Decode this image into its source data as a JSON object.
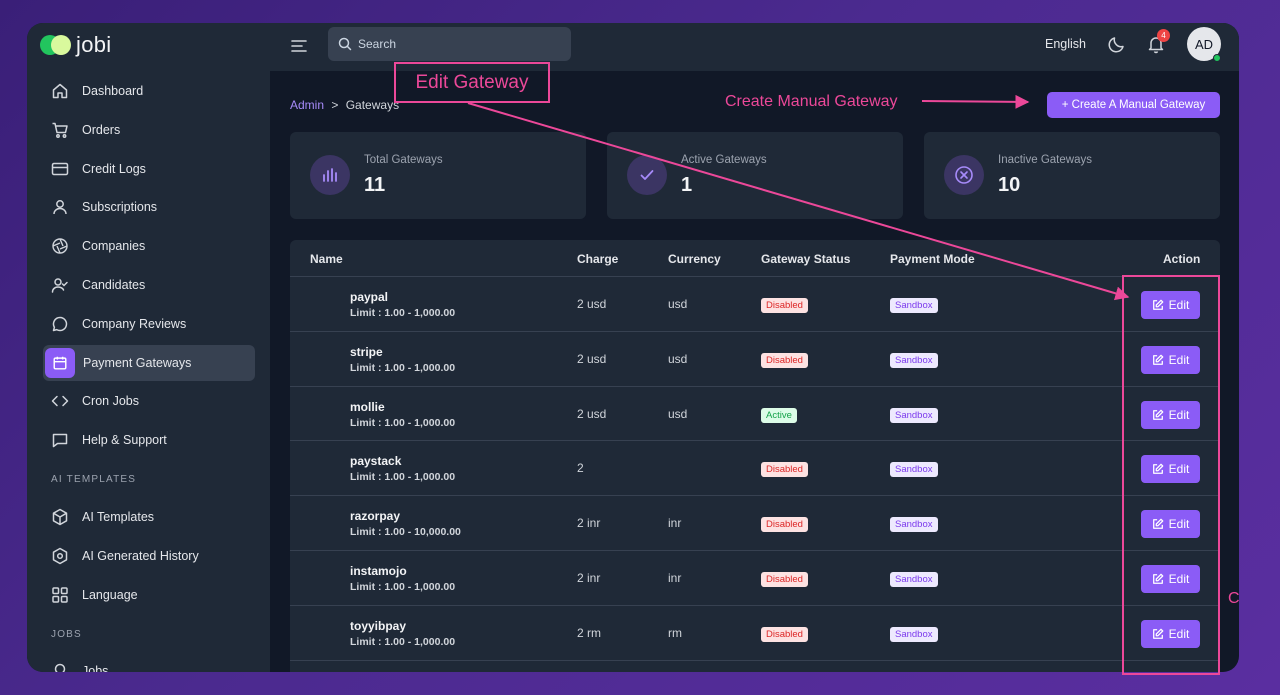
{
  "app": {
    "name": "jobi"
  },
  "sidebar": {
    "items": [
      {
        "label": "Dashboard",
        "icon": "home-icon"
      },
      {
        "label": "Orders",
        "icon": "cart-icon"
      },
      {
        "label": "Credit Logs",
        "icon": "credit-card-icon"
      },
      {
        "label": "Subscriptions",
        "icon": "user-icon"
      },
      {
        "label": "Companies",
        "icon": "aperture-icon"
      },
      {
        "label": "Candidates",
        "icon": "user-check-icon"
      },
      {
        "label": "Company Reviews",
        "icon": "chat-bubble-icon"
      },
      {
        "label": "Payment Gateways",
        "icon": "calendar-icon",
        "active": true
      },
      {
        "label": "Cron Jobs",
        "icon": "code-icon"
      },
      {
        "label": "Help & Support",
        "icon": "message-square-icon"
      }
    ],
    "section_ai": "AI TEMPLATES",
    "ai_items": [
      {
        "label": "AI Templates",
        "icon": "cube-icon"
      },
      {
        "label": "AI Generated History",
        "icon": "hexagon-icon"
      },
      {
        "label": "Language",
        "icon": "grid-icon"
      }
    ],
    "section_jobs": "JOBS",
    "jobs_items": [
      {
        "label": "Jobs",
        "icon": "pin-icon"
      }
    ]
  },
  "topbar": {
    "search_placeholder": "Search",
    "language": "English",
    "notification_count": "4",
    "avatar_initials": "AD"
  },
  "breadcrumb": {
    "root": "Admin",
    "separator": ">",
    "current": "Gateways"
  },
  "create_button": "+ Create A Manual Gateway",
  "stats": [
    {
      "label": "Total Gateways",
      "value": "11"
    },
    {
      "label": "Active Gateways",
      "value": "1"
    },
    {
      "label": "Inactive Gateways",
      "value": "10"
    }
  ],
  "table": {
    "headers": {
      "name": "Name",
      "charge": "Charge",
      "currency": "Currency",
      "status": "Gateway Status",
      "mode": "Payment Mode",
      "action": "Action"
    },
    "edit_label": "Edit",
    "rows": [
      {
        "name": "paypal",
        "limit": "Limit : 1.00 - 1,000.00",
        "charge": "2 usd",
        "currency": "usd",
        "status": "Disabled",
        "mode": "Sandbox"
      },
      {
        "name": "stripe",
        "limit": "Limit : 1.00 - 1,000.00",
        "charge": "2 usd",
        "currency": "usd",
        "status": "Disabled",
        "mode": "Sandbox"
      },
      {
        "name": "mollie",
        "limit": "Limit : 1.00 - 1,000.00",
        "charge": "2 usd",
        "currency": "usd",
        "status": "Active",
        "mode": "Sandbox"
      },
      {
        "name": "paystack",
        "limit": "Limit : 1.00 - 1,000.00",
        "charge": "2",
        "currency": "",
        "status": "Disabled",
        "mode": "Sandbox"
      },
      {
        "name": "razorpay",
        "limit": "Limit : 1.00 - 10,000.00",
        "charge": "2 inr",
        "currency": "inr",
        "status": "Disabled",
        "mode": "Sandbox"
      },
      {
        "name": "instamojo",
        "limit": "Limit : 1.00 - 1,000.00",
        "charge": "2 inr",
        "currency": "inr",
        "status": "Disabled",
        "mode": "Sandbox"
      },
      {
        "name": "toyyibpay",
        "limit": "Limit : 1.00 - 1,000.00",
        "charge": "2 rm",
        "currency": "rm",
        "status": "Disabled",
        "mode": "Sandbox"
      }
    ]
  },
  "annotations": {
    "edit_gateway": "Edit Gateway",
    "create_manual_gateway": "Create Manual Gateway",
    "partial_letter": "C"
  },
  "colors": {
    "accent": "#8b5cf6",
    "annotation": "#ec4899"
  }
}
